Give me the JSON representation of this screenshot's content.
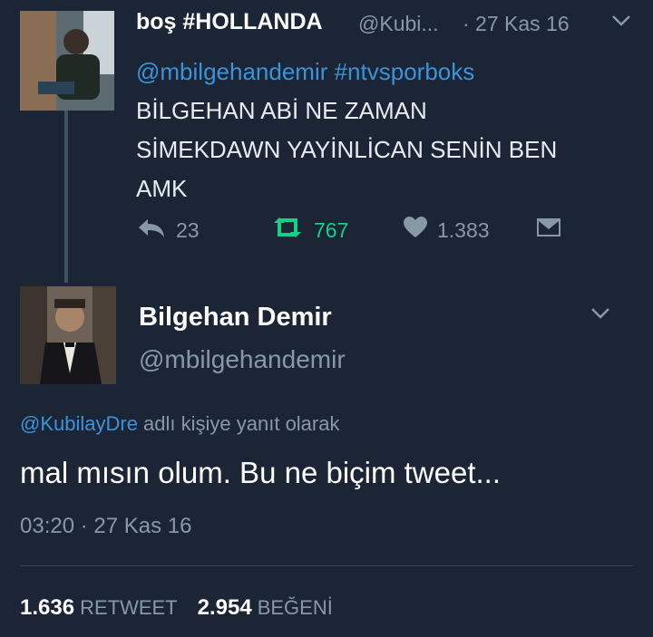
{
  "tweet1": {
    "display_name": "boş #HOLLANDA",
    "handle": "@Kubi...",
    "timestamp": "· 27 Kas 16",
    "mentions": "@mbilgehandemir #ntvsporboks",
    "lines": [
      "BİLGEHAN ABİ NE ZAMAN",
      "SİMEKDAWN YAYİNLİCAN SENİN BEN",
      "AMK"
    ],
    "replies": "23",
    "retweets": "767",
    "likes": "1.383"
  },
  "tweet2": {
    "display_name": "Bilgehan Demir",
    "handle": "@mbilgehandemir",
    "reply_to_handle": "@KubilayDre",
    "reply_to_suffix": " adlı kişiye yanıt olarak",
    "text": "mal mısın olum. Bu ne biçim tweet...",
    "timestamp": "03:20 · 27 Kas 16",
    "retweet_count": "1.636",
    "retweet_label": "RETWEET",
    "like_count": "2.954",
    "like_label": "BEĞENİ"
  },
  "icons": {
    "reply": "reply-icon",
    "retweet": "retweet-icon",
    "like": "heart-icon",
    "dm": "envelope-icon",
    "menu": "chevron-down-icon"
  },
  "colors": {
    "background": "#1b2536",
    "link": "#3b94d9",
    "retweet_active": "#19cf86",
    "muted": "#8899a6"
  }
}
